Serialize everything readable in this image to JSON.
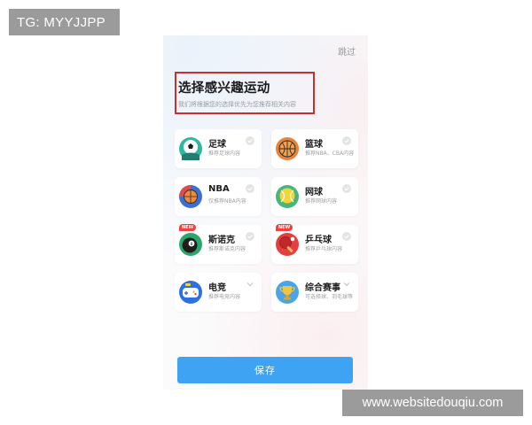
{
  "watermarks": {
    "top_left": "TG: MYYJJPP",
    "bottom_right": "www.websitedouqiu.com"
  },
  "header": {
    "skip_label": "跳过",
    "title": "选择感兴趣运动",
    "subtitle": "我们将根据您的选择优先为您推荐相关内容"
  },
  "sports": [
    {
      "name": "足球",
      "desc": "推荐足球内容",
      "icon": "soccer-ball-icon",
      "badge": "",
      "selected_indicator": "check"
    },
    {
      "name": "篮球",
      "desc": "推荐NBA、CBA内容",
      "icon": "basketball-icon",
      "badge": "",
      "selected_indicator": "check"
    },
    {
      "name": "NBA",
      "desc": "仅推荐NBA内容",
      "icon": "nba-basketball-icon",
      "badge": "",
      "selected_indicator": "check"
    },
    {
      "name": "网球",
      "desc": "推荐网球内容",
      "icon": "tennis-ball-icon",
      "badge": "",
      "selected_indicator": "check"
    },
    {
      "name": "斯诺克",
      "desc": "推荐斯诺克内容",
      "icon": "snooker-ball-icon",
      "badge": "NEW",
      "selected_indicator": "check"
    },
    {
      "name": "乒乓球",
      "desc": "推荐乒乓球内容",
      "icon": "ping-pong-icon",
      "badge": "NEW",
      "selected_indicator": "check"
    },
    {
      "name": "电竞",
      "desc": "推荐电竞内容",
      "icon": "gamepad-icon",
      "badge": "",
      "selected_indicator": "chevron"
    },
    {
      "name": "综合赛事",
      "desc": "可选择球、羽毛球等",
      "icon": "trophy-icon",
      "badge": "",
      "selected_indicator": "chevron"
    }
  ],
  "footer": {
    "save_label": "保存"
  },
  "colors": {
    "accent": "#3fa3f3",
    "highlight_border": "#c9302c",
    "badge": "#e8453c"
  }
}
